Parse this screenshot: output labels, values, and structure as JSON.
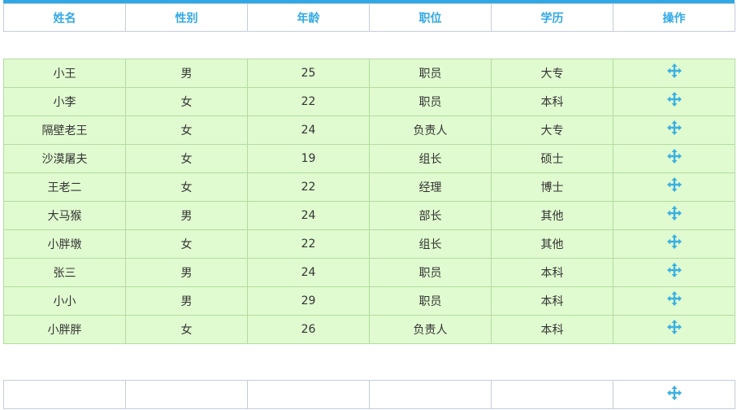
{
  "accent_color": "#2fa8e6",
  "row_color": "#e0fbd0",
  "headers": [
    "姓名",
    "性别",
    "年龄",
    "职位",
    "学历",
    "操作"
  ],
  "rows": [
    {
      "name": "小王",
      "gender": "男",
      "age": "25",
      "position": "职员",
      "education": "大专",
      "action_icon": "move-icon"
    },
    {
      "name": "小李",
      "gender": "女",
      "age": "22",
      "position": "职员",
      "education": "本科",
      "action_icon": "move-icon"
    },
    {
      "name": "隔壁老王",
      "gender": "女",
      "age": "24",
      "position": "负责人",
      "education": "大专",
      "action_icon": "move-icon"
    },
    {
      "name": "沙漠屠夫",
      "gender": "女",
      "age": "19",
      "position": "组长",
      "education": "硕士",
      "action_icon": "move-icon"
    },
    {
      "name": "王老二",
      "gender": "女",
      "age": "22",
      "position": "经理",
      "education": "博士",
      "action_icon": "move-icon"
    },
    {
      "name": "大马猴",
      "gender": "男",
      "age": "24",
      "position": "部长",
      "education": "其他",
      "action_icon": "move-icon"
    },
    {
      "name": "小胖墩",
      "gender": "女",
      "age": "22",
      "position": "组长",
      "education": "其他",
      "action_icon": "move-icon"
    },
    {
      "name": "张三",
      "gender": "男",
      "age": "24",
      "position": "职员",
      "education": "本科",
      "action_icon": "move-icon"
    },
    {
      "name": "小小",
      "gender": "男",
      "age": "29",
      "position": "职员",
      "education": "本科",
      "action_icon": "move-icon"
    },
    {
      "name": "小胖胖",
      "gender": "女",
      "age": "26",
      "position": "负责人",
      "education": "本科",
      "action_icon": "move-icon"
    }
  ],
  "footer_row": {
    "name": "",
    "gender": "",
    "age": "",
    "position": "",
    "education": "",
    "action_icon": "move-icon"
  }
}
